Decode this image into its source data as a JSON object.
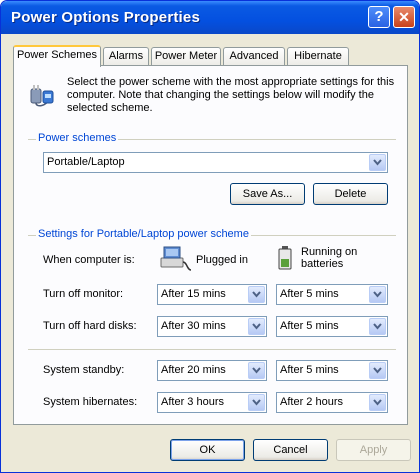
{
  "window": {
    "title": "Power Options Properties",
    "help_glyph": "?",
    "close_glyph": "✕"
  },
  "tabs": [
    {
      "label": "Power Schemes",
      "active": true
    },
    {
      "label": "Alarms"
    },
    {
      "label": "Power Meter"
    },
    {
      "label": "Advanced"
    },
    {
      "label": "Hibernate"
    }
  ],
  "description": "Select the power scheme with the most appropriate settings for this computer. Note that changing the settings below will modify the selected scheme.",
  "power_schemes": {
    "label": "Power schemes",
    "selected": "Portable/Laptop",
    "save_as_label": "Save As...",
    "delete_label": "Delete"
  },
  "settings": {
    "label": "Settings for Portable/Laptop power scheme",
    "when_label": "When computer is:",
    "plugged_in_label": "Plugged in",
    "batteries_label": "Running on batteries",
    "rows": [
      {
        "label": "Turn off monitor:",
        "plugged": "After 15 mins",
        "battery": "After 5 mins"
      },
      {
        "label": "Turn off hard disks:",
        "plugged": "After 30 mins",
        "battery": "After 5 mins"
      },
      {
        "label": "System standby:",
        "plugged": "After 20 mins",
        "battery": "After 5 mins"
      },
      {
        "label": "System hibernates:",
        "plugged": "After 3 hours",
        "battery": "After 2 hours"
      }
    ]
  },
  "footer": {
    "ok_label": "OK",
    "cancel_label": "Cancel",
    "apply_label": "Apply"
  },
  "colors": {
    "titlebar": "#0450e0",
    "group_label": "#0046d5",
    "active_tab_accent": "#ffc83c"
  }
}
